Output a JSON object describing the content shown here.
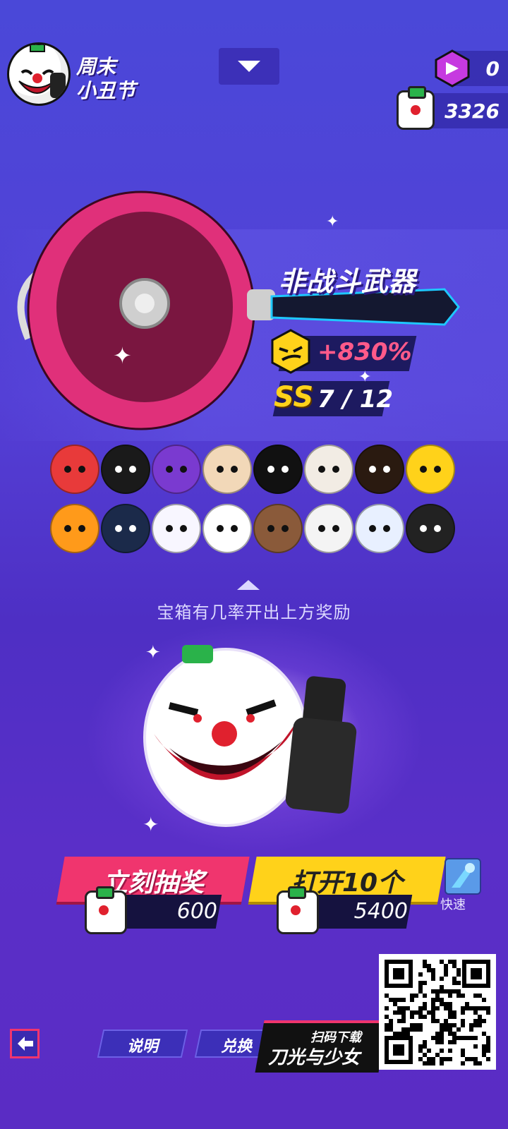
{
  "event": {
    "title_line1": "周末",
    "title_line2": "小丑节"
  },
  "currency": {
    "gem_count": "0",
    "ticket_count": "3326"
  },
  "weapon": {
    "type_label": "非战斗武器",
    "bonus": "+830%",
    "rank_grade": "SS",
    "rank_count": "7 / 12"
  },
  "rewards_hint": "宝箱有几率开出上方奖励",
  "rewards": [
    {
      "name": "nutcracker-hat-reward",
      "color": "#e83a3a"
    },
    {
      "name": "black-hair-halo-reward",
      "color": "#1a1a1a"
    },
    {
      "name": "rider-helmet-reward",
      "color": "#7a3ad0"
    },
    {
      "name": "blonde-hair-reward",
      "color": "#f2d8b8"
    },
    {
      "name": "black-bunny-reward",
      "color": "#111111"
    },
    {
      "name": "skull-horns-reward",
      "color": "#f2ece4"
    },
    {
      "name": "orange-visor-helmet-reward",
      "color": "#2a1a10"
    },
    {
      "name": "yellow-block-head-reward",
      "color": "#ffd21a"
    },
    {
      "name": "pumpkin-reward",
      "color": "#ff9a1a"
    },
    {
      "name": "knight-helmet-reward",
      "color": "#1b2a4a"
    },
    {
      "name": "white-bunny-reward",
      "color": "#f8f6ff"
    },
    {
      "name": "clown-head-reward",
      "color": "#ffffff"
    },
    {
      "name": "bear-head-reward",
      "color": "#8a5a3a"
    },
    {
      "name": "box-head-reward",
      "color": "#f4f4f4"
    },
    {
      "name": "fish-head-reward",
      "color": "#e8f0ff"
    },
    {
      "name": "skull-hood-reward",
      "color": "#222222"
    }
  ],
  "actions": {
    "draw_label": "立刻抽奖",
    "draw_cost": "600",
    "open10_label": "打开10个",
    "open10_cost": "5400",
    "fast_label": "快速"
  },
  "bottom": {
    "info_label": "说明",
    "exchange_label": "兑换"
  },
  "promo": {
    "sub": "扫码下载",
    "name": "刀光与少女"
  },
  "colors": {
    "accent_pink": "#f0356e",
    "accent_yellow": "#ffd21a",
    "bg_purple": "#4e2fc4"
  }
}
